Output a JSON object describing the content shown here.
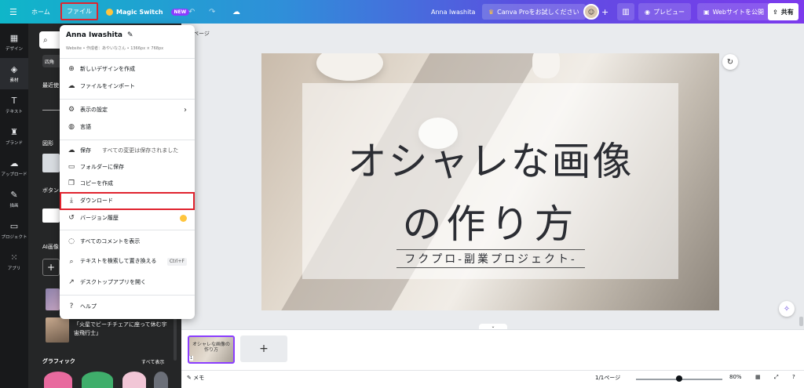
{
  "topbar": {
    "home": "ホーム",
    "file": "ファイル",
    "magic_switch": "Magic Switch",
    "new_badge": "NEW",
    "user_name": "Anna Iwashita",
    "canva_pro": "Canva Proをお試しください",
    "preview": "プレビュー",
    "publish": "Webサイトを公開",
    "share": "共有"
  },
  "rail": {
    "items": [
      {
        "label": "デザイン"
      },
      {
        "label": "素材"
      },
      {
        "label": "テキスト"
      },
      {
        "label": "ブランド"
      },
      {
        "label": "アップロード"
      },
      {
        "label": "描画"
      },
      {
        "label": "プロジェクト"
      },
      {
        "label": "アプリ"
      }
    ]
  },
  "panel": {
    "chip": "四角",
    "recent": "最近使",
    "shapes": "図形",
    "buttons": "ボタン",
    "ai_images": "AI画像",
    "thumb_caption": "「火星でビーチチェアに座って休む宇宙飛行士」",
    "graphics": "グラフィック",
    "see_all": "すべて表示"
  },
  "menu": {
    "user": "Anna Iwashita",
    "subtitle": "Website • 作成者：あやいなさん • 1366px × 768px",
    "items": {
      "new_design": "新しいデザインを作成",
      "import": "ファイルをインポート",
      "view_settings": "表示の設定",
      "language": "言語",
      "save": "保存",
      "save_status": "すべての変更は保存されました",
      "save_folder": "フォルダーに保存",
      "copy": "コピーを作成",
      "download": "ダウンロード",
      "history": "バージョン履歴",
      "comments": "すべてのコメントを表示",
      "find_replace": "テキストを検索して置き換える",
      "find_shortcut": "Ctrl+F",
      "desktop": "デスクトップアプリを開く",
      "help": "ヘルプ"
    }
  },
  "canvas": {
    "page_label": "ページ",
    "title_line1": "オシャレな画像",
    "title_line2": "の作り方",
    "subtitle": "フクプロ-副業プロジェクト-"
  },
  "pages": {
    "thumb_text": "オシャレな画像の作り方",
    "page_number": "1"
  },
  "bottombar": {
    "notes": "メモ",
    "page_count": "1/1ページ",
    "zoom": "80%",
    "zoom_value": 0.5
  },
  "colors": {
    "accent": "#8b3dff",
    "highlight": "#e0232e",
    "rail_bg": "#18191b"
  }
}
